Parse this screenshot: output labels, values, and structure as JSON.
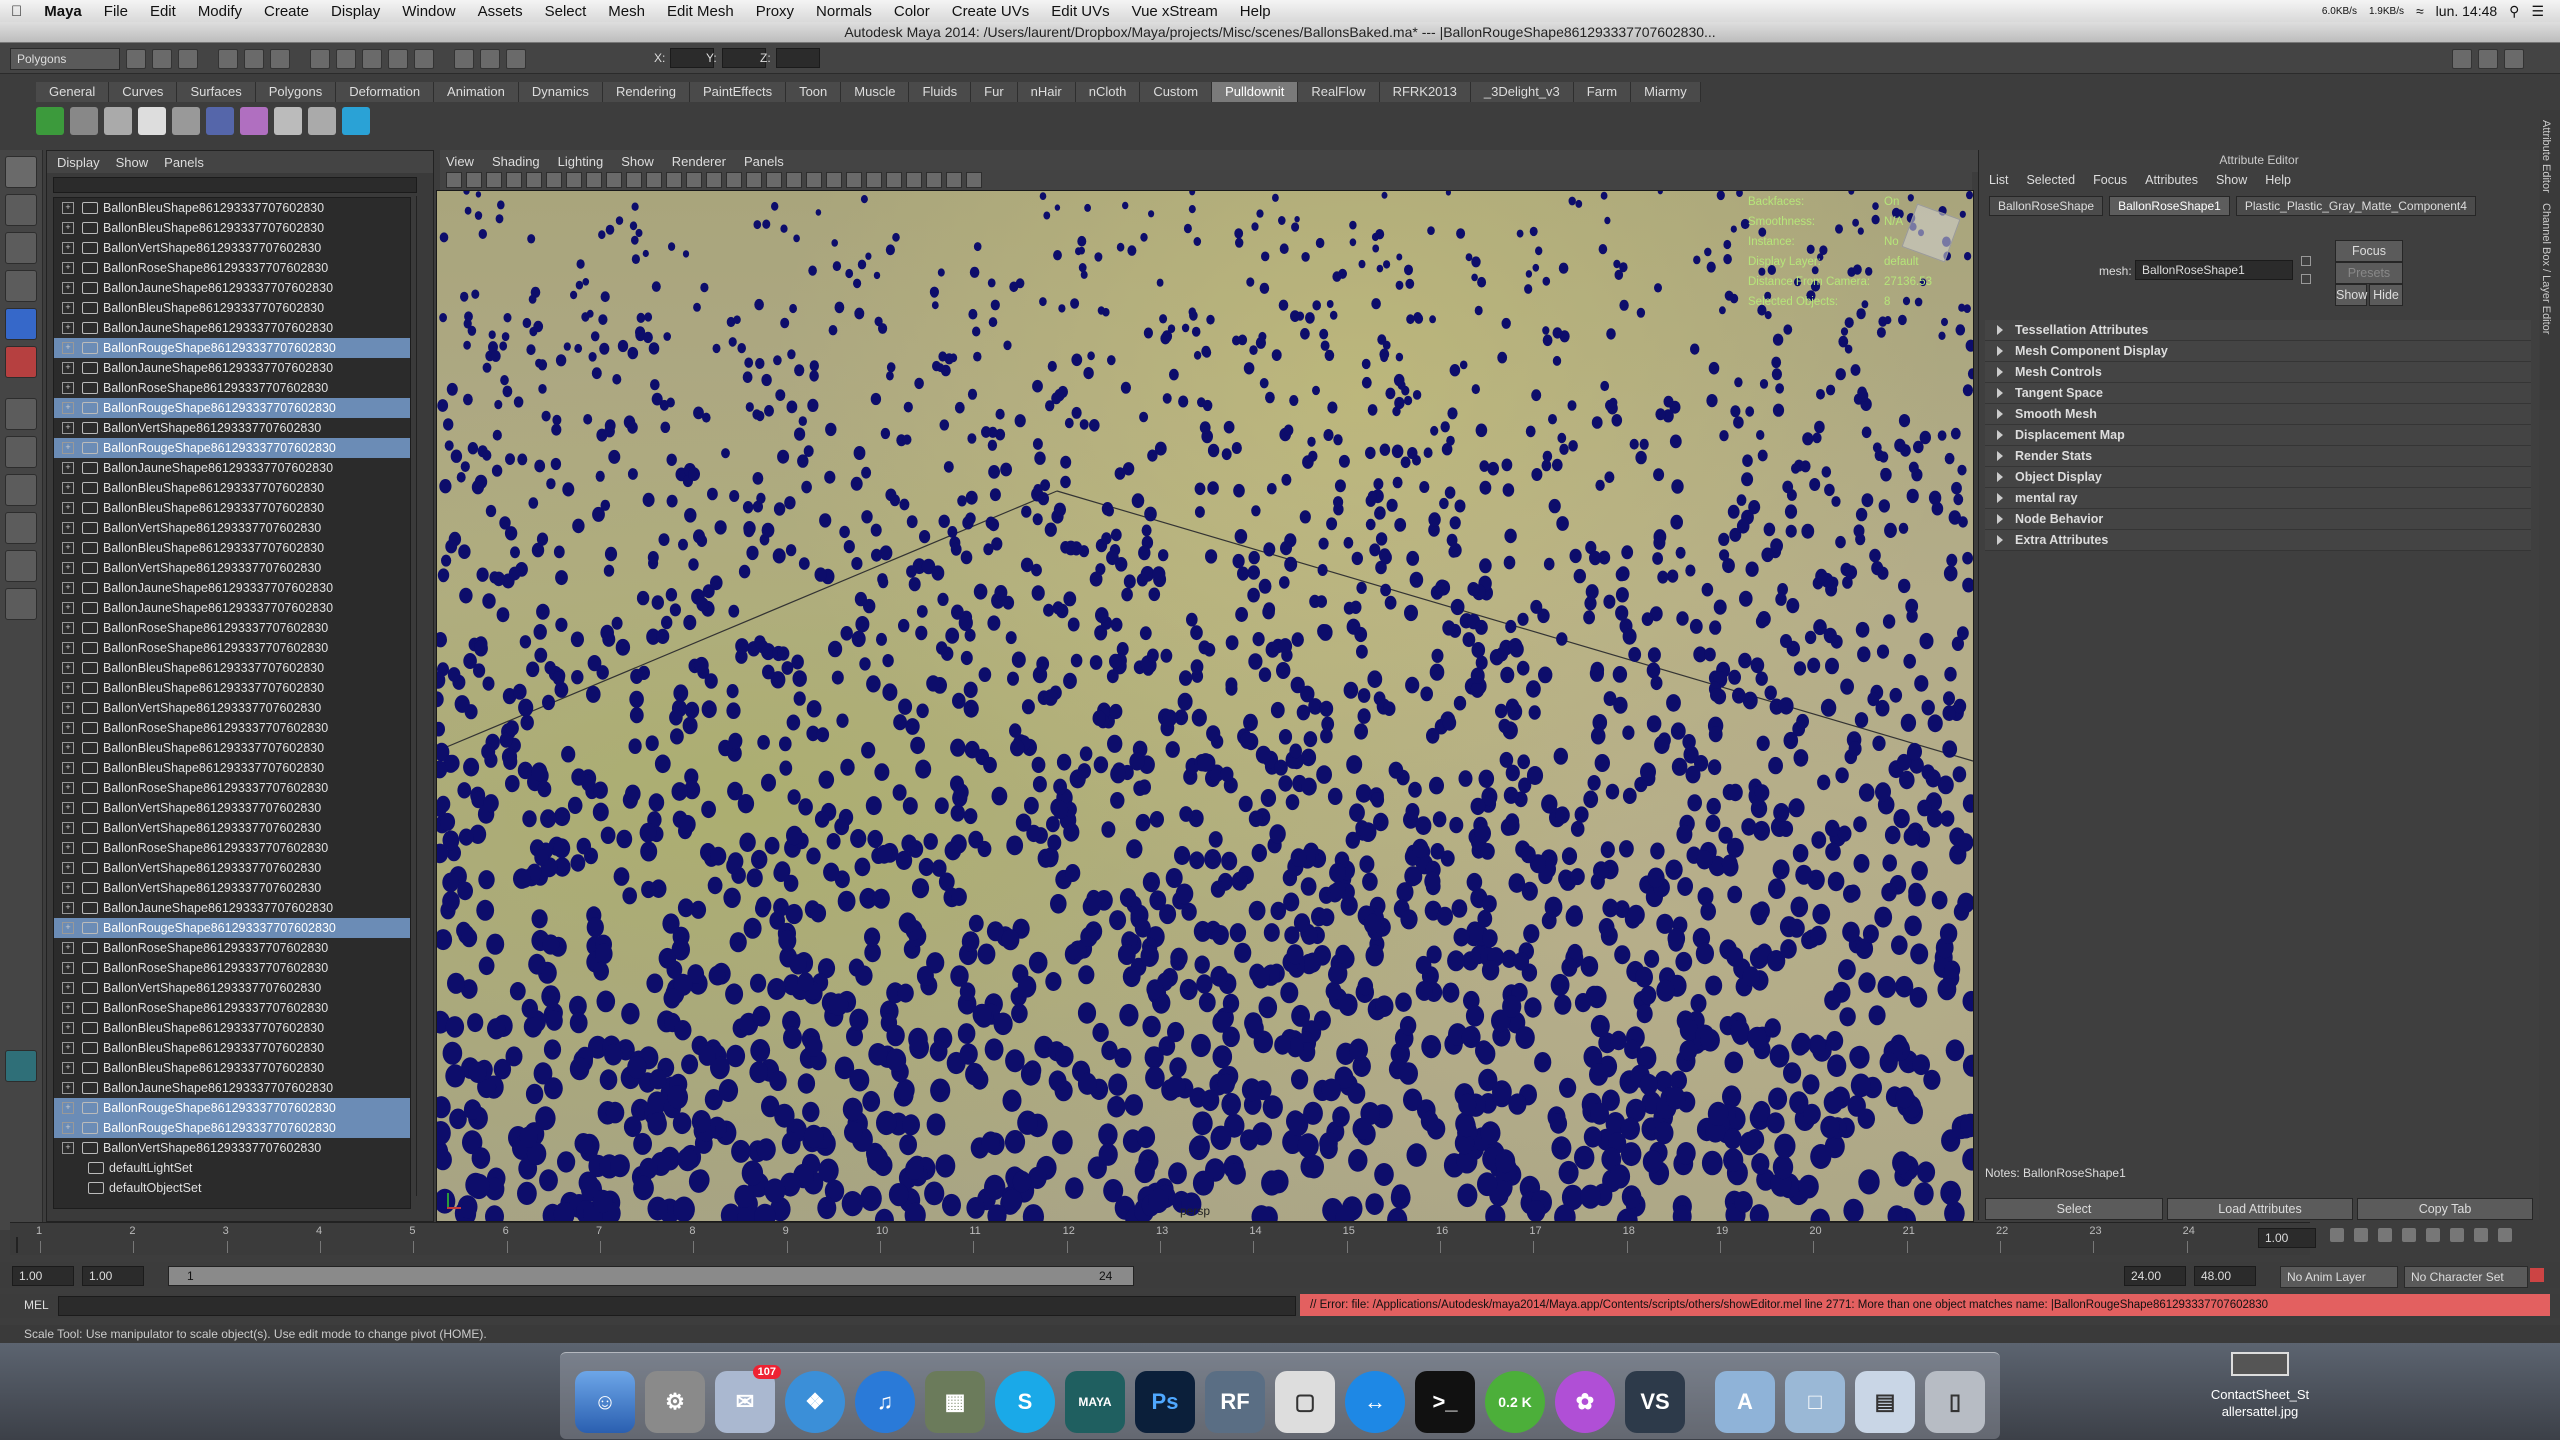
{
  "mac_menubar": {
    "app": "Maya",
    "items": [
      "File",
      "Edit",
      "Modify",
      "Create",
      "Display",
      "Window",
      "Assets",
      "Select",
      "Mesh",
      "Edit Mesh",
      "Proxy",
      "Normals",
      "Color",
      "Create UVs",
      "Edit UVs",
      "Vue xStream",
      "Help"
    ],
    "clock": "lun. 14:48",
    "net_up": "6.0KB/s",
    "net_down": "1.9KB/s"
  },
  "window_title": "Autodesk Maya 2014: /Users/laurent/Dropbox/Maya/projects/Misc/scenes/BallonsBaked.ma* --- |BallonRougeShape861293337707602830...",
  "status_line": {
    "menu_set": "Polygons",
    "x_label": "X:",
    "y_label": "Y:",
    "z_label": "Z:"
  },
  "shelf_tabs": [
    "General",
    "Curves",
    "Surfaces",
    "Polygons",
    "Deformation",
    "Animation",
    "Dynamics",
    "Rendering",
    "PaintEffects",
    "Toon",
    "Muscle",
    "Fluids",
    "Fur",
    "nHair",
    "nCloth",
    "Custom",
    "Pulldownit",
    "RealFlow",
    "RFRK2013",
    "_3Delight_v3",
    "Farm",
    "Miarmy"
  ],
  "active_shelf_tab": "Pulldownit",
  "outliner": {
    "menu": [
      "Display",
      "Show",
      "Panels"
    ],
    "rows": [
      {
        "label": "BallonBleuShape861293337707602830",
        "selected": false
      },
      {
        "label": "BallonBleuShape861293337707602830",
        "selected": false
      },
      {
        "label": "BallonVertShape861293337707602830",
        "selected": false
      },
      {
        "label": "BallonRoseShape861293337707602830",
        "selected": false
      },
      {
        "label": "BallonJauneShape861293337707602830",
        "selected": false
      },
      {
        "label": "BallonBleuShape861293337707602830",
        "selected": false
      },
      {
        "label": "BallonJauneShape861293337707602830",
        "selected": false
      },
      {
        "label": "BallonRougeShape861293337707602830",
        "selected": true
      },
      {
        "label": "BallonJauneShape861293337707602830",
        "selected": false
      },
      {
        "label": "BallonRoseShape861293337707602830",
        "selected": false
      },
      {
        "label": "BallonRougeShape861293337707602830",
        "selected": true
      },
      {
        "label": "BallonVertShape861293337707602830",
        "selected": false
      },
      {
        "label": "BallonRougeShape861293337707602830",
        "selected": true
      },
      {
        "label": "BallonJauneShape861293337707602830",
        "selected": false
      },
      {
        "label": "BallonBleuShape861293337707602830",
        "selected": false
      },
      {
        "label": "BallonBleuShape861293337707602830",
        "selected": false
      },
      {
        "label": "BallonVertShape861293337707602830",
        "selected": false
      },
      {
        "label": "BallonBleuShape861293337707602830",
        "selected": false
      },
      {
        "label": "BallonVertShape861293337707602830",
        "selected": false
      },
      {
        "label": "BallonJauneShape861293337707602830",
        "selected": false
      },
      {
        "label": "BallonJauneShape861293337707602830",
        "selected": false
      },
      {
        "label": "BallonRoseShape861293337707602830",
        "selected": false
      },
      {
        "label": "BallonRoseShape861293337707602830",
        "selected": false
      },
      {
        "label": "BallonBleuShape861293337707602830",
        "selected": false
      },
      {
        "label": "BallonBleuShape861293337707602830",
        "selected": false
      },
      {
        "label": "BallonVertShape861293337707602830",
        "selected": false
      },
      {
        "label": "BallonRoseShape861293337707602830",
        "selected": false
      },
      {
        "label": "BallonBleuShape861293337707602830",
        "selected": false
      },
      {
        "label": "BallonBleuShape861293337707602830",
        "selected": false
      },
      {
        "label": "BallonRoseShape861293337707602830",
        "selected": false
      },
      {
        "label": "BallonVertShape861293337707602830",
        "selected": false
      },
      {
        "label": "BallonVertShape861293337707602830",
        "selected": false
      },
      {
        "label": "BallonRoseShape861293337707602830",
        "selected": false
      },
      {
        "label": "BallonVertShape861293337707602830",
        "selected": false
      },
      {
        "label": "BallonVertShape861293337707602830",
        "selected": false
      },
      {
        "label": "BallonJauneShape861293337707602830",
        "selected": false
      },
      {
        "label": "BallonRougeShape861293337707602830",
        "selected": true
      },
      {
        "label": "BallonRoseShape861293337707602830",
        "selected": false
      },
      {
        "label": "BallonRoseShape861293337707602830",
        "selected": false
      },
      {
        "label": "BallonVertShape861293337707602830",
        "selected": false
      },
      {
        "label": "BallonRoseShape861293337707602830",
        "selected": false
      },
      {
        "label": "BallonBleuShape861293337707602830",
        "selected": false
      },
      {
        "label": "BallonBleuShape861293337707602830",
        "selected": false
      },
      {
        "label": "BallonBleuShape861293337707602830",
        "selected": false
      },
      {
        "label": "BallonJauneShape861293337707602830",
        "selected": false
      },
      {
        "label": "BallonRougeShape861293337707602830",
        "selected": true
      },
      {
        "label": "BallonRougeShape861293337707602830",
        "selected": true
      },
      {
        "label": "BallonVertShape861293337707602830",
        "selected": false
      },
      {
        "label": "defaultLightSet",
        "selected": false
      },
      {
        "label": "defaultObjectSet",
        "selected": false
      }
    ]
  },
  "viewport": {
    "menu": [
      "View",
      "Shading",
      "Lighting",
      "Show",
      "Renderer",
      "Panels"
    ],
    "hud": [
      {
        "label": "Backfaces:",
        "value": "On"
      },
      {
        "label": "Smoothness:",
        "value": "N/A"
      },
      {
        "label": "Instance:",
        "value": "No"
      },
      {
        "label": "Display Layer:",
        "value": "default"
      },
      {
        "label": "Distance From Camera:",
        "value": "27136.53"
      },
      {
        "label": "Selected Objects:",
        "value": "8"
      }
    ],
    "camera": "persp",
    "balloon_color": "#0d0d6b"
  },
  "attribute_editor": {
    "title": "Attribute Editor",
    "menu": [
      "List",
      "Selected",
      "Focus",
      "Attributes",
      "Show",
      "Help"
    ],
    "tabs": [
      "BallonRoseShape",
      "BallonRoseShape1",
      "Plastic_Plastic_Gray_Matte_Component4"
    ],
    "active_tab": "BallonRoseShape1",
    "mesh_label": "mesh:",
    "mesh_value": "BallonRoseShape1",
    "focus_btn": "Focus",
    "presets_btn": "Presets",
    "show_btn": "Show",
    "hide_btn": "Hide",
    "sections": [
      "Tessellation Attributes",
      "Mesh Component Display",
      "Mesh Controls",
      "Tangent Space",
      "Smooth Mesh",
      "Displacement Map",
      "Render Stats",
      "Object Display",
      "mental ray",
      "Node Behavior",
      "Extra Attributes"
    ],
    "notes": "Notes:  BallonRoseShape1",
    "select_btn": "Select",
    "load_btn": "Load Attributes",
    "copy_btn": "Copy Tab",
    "side_tabs": [
      "Attribute Editor",
      "Channel Box / Layer Editor"
    ]
  },
  "timeline": {
    "frames": [
      "1",
      "2",
      "3",
      "4",
      "5",
      "6",
      "7",
      "8",
      "9",
      "10",
      "11",
      "12",
      "13",
      "14",
      "15",
      "16",
      "17",
      "18",
      "19",
      "20",
      "21",
      "22",
      "23",
      "24"
    ],
    "current_frame": "1.00"
  },
  "range": {
    "start": "1.00",
    "start2": "1.00",
    "slider_start": "1",
    "slider_end": "24",
    "end": "24.00",
    "end2": "48.00",
    "anim_layer": "No Anim Layer",
    "char_set": "No Character Set"
  },
  "command_line": {
    "label": "MEL",
    "error": "// Error: file: /Applications/Autodesk/maya2014/Maya.app/Contents/scripts/others/showEditor.mel line 2771: More than one object matches name: |BallonRougeShape861293337707602830"
  },
  "help_line": "Scale Tool: Use manipulator to scale object(s). Use edit mode to change pivot (HOME).",
  "dock": {
    "badge_count": "107",
    "utorrent_label": "0.2 K",
    "maya_label": "MAYA",
    "photoshop_label": "Ps",
    "realflow_label": "RF",
    "skype_label": "S",
    "vue_label": "VS"
  },
  "desktop": {
    "file_label1": "ContactSheet_St",
    "file_label2": "allersattel.jpg"
  }
}
